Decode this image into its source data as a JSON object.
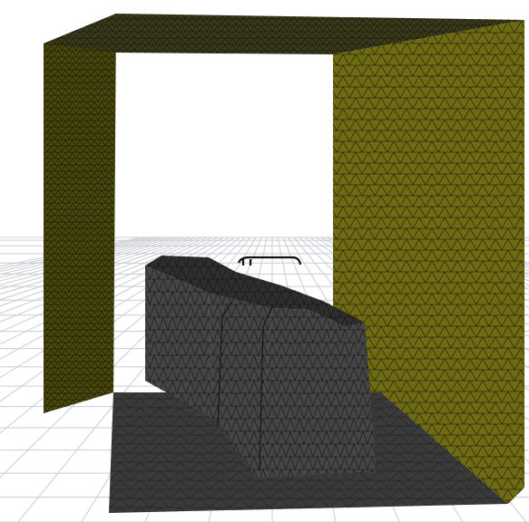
{
  "viewport": {
    "background": "#ffffff",
    "ground_grid_color": "#c9cdd1",
    "wall_color": "#6f6b12",
    "wall_dark_color": "#4a4808",
    "top_color": "#3a3a18",
    "floor_color": "#3a3a3a",
    "body_color": "#454545",
    "body_dark_color": "#2e2e2e",
    "mesh_line_color": "#111111",
    "fixture_color": "#111111"
  }
}
